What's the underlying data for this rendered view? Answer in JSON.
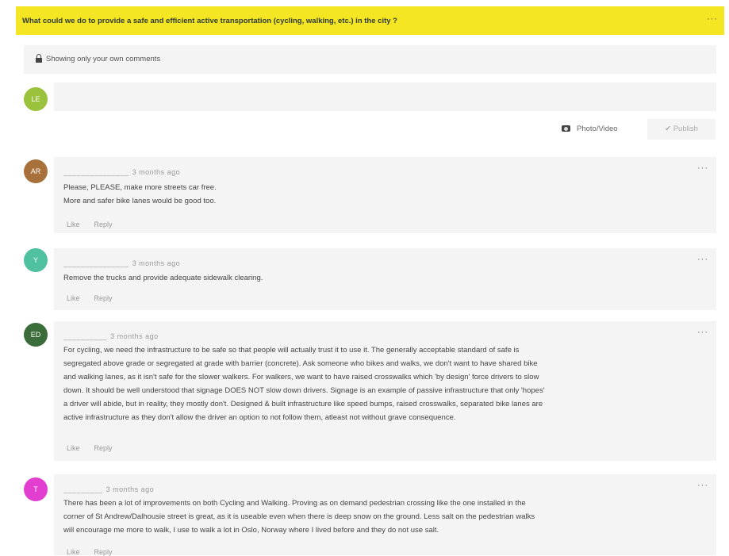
{
  "question": {
    "text": "What could we do to provide a safe and efficient active transportation (cycling, walking, etc.) in the city ?",
    "menu": "···"
  },
  "privacy": {
    "text": "Showing only your own comments"
  },
  "composer": {
    "avatar_initials": "LE",
    "photo_label": "Photo/Video",
    "publish_label": "Publish"
  },
  "comments": [
    {
      "avatar": "AR",
      "author": "_______________",
      "time": "3 months ago",
      "lines": [
        "Please, PLEASE, make more streets car free.",
        "More and safer bike lanes would be good too."
      ],
      "like": "Like",
      "reply": "Reply",
      "menu": "···"
    },
    {
      "avatar": "Y",
      "author": "_______________",
      "time": "3 months ago",
      "lines": [
        "Remove the trucks and provide adequate sidewalk clearing."
      ],
      "like": "Like",
      "reply": "Reply",
      "menu": "···"
    },
    {
      "avatar": "ED",
      "author": "__________",
      "time": "3 months ago",
      "lines": [
        "For cycling, we need the infrastructure to be safe so that people will actually trust it to use it. The generally acceptable standard of safe is",
        "segregated above grade or segregated at grade with barrier (concrete). Ask someone who bikes and walks, we don't want to have shared bike",
        "and walking lanes, as it isn't safe for the slower walkers. For walkers, we want to have raised crosswalks which 'by design' force drivers to slow",
        "down. It should be well understood that signage DOES NOT slow down drivers. Signage is an example of passive infrastructure that only 'hopes'",
        "a driver will abide, but in reality, they mostly don't. Designed & built infrastructure like speed bumps, raised crosswalks, separated bike lanes are",
        "active infrastructure as they don't allow the driver an option to not follow them, atleast not without grave consequence."
      ],
      "like": "Like",
      "reply": "Reply",
      "menu": "···"
    },
    {
      "avatar": "T",
      "author": "_________",
      "time": "3 months ago",
      "lines": [
        "There has been a lot of improvements on both Cycling and Walking. Proving as on demand pedestrian crossing like the one installed in the",
        "corner of St Andrew/Dalhousie street is great, as it is useable even when there is deep snow on the ground. Less salt on the pedestrian walks",
        "will encourage me more to walk, I use to walk a lot in Oslo, Norway where I lived before and they do not use salt."
      ],
      "like": "Like",
      "reply": "Reply",
      "menu": "···"
    }
  ],
  "colors": {
    "question_bg": "#f4e623",
    "composer_avatar": "#9bc23c",
    "avatars": [
      "#a8703a",
      "#4fc1a0",
      "#3a6d3a",
      "#e23fd0"
    ]
  }
}
